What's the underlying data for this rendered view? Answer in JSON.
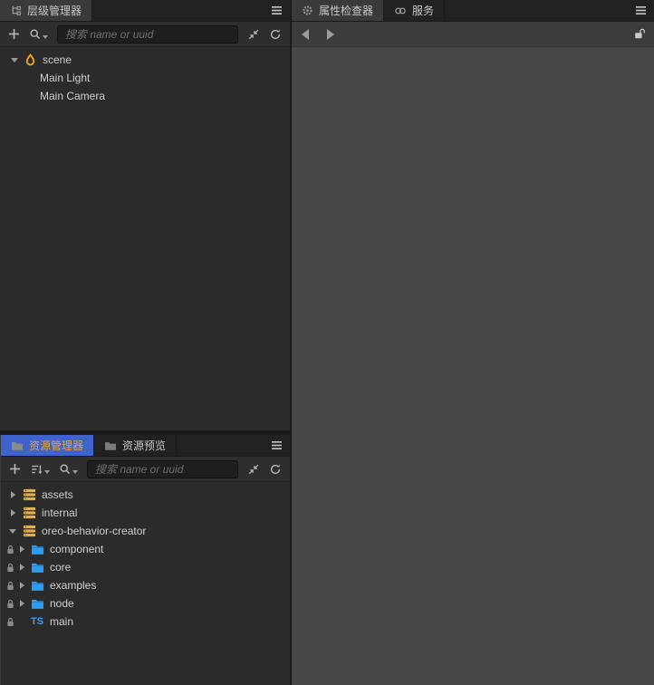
{
  "colors": {
    "focused_tab_blue": "#3e63cc",
    "focused_tab_text_orange": "#eda33d",
    "scene_icon_orange": "#f5a623",
    "folder_blue": "#2e9df0",
    "bundle_yellow": "#e0b050",
    "ts_blue": "#3f9df5"
  },
  "hierarchy": {
    "tab_label": "层级管理器",
    "search_placeholder": "搜索 name or uuid",
    "nodes": [
      {
        "label": "scene"
      },
      {
        "label": "Main Light"
      },
      {
        "label": "Main Camera"
      }
    ]
  },
  "assets": {
    "tab_manager": "资源管理器",
    "tab_preview": "资源预览",
    "search_placeholder": "搜索 name or uuid",
    "ts_badge": "TS",
    "nodes": [
      {
        "label": "assets"
      },
      {
        "label": "internal"
      },
      {
        "label": "oreo-behavior-creator"
      },
      {
        "label": "component"
      },
      {
        "label": "core"
      },
      {
        "label": "examples"
      },
      {
        "label": "node"
      },
      {
        "label": "main"
      }
    ]
  },
  "inspector": {
    "tab_inspector": "属性检查器",
    "tab_service": "服务"
  }
}
